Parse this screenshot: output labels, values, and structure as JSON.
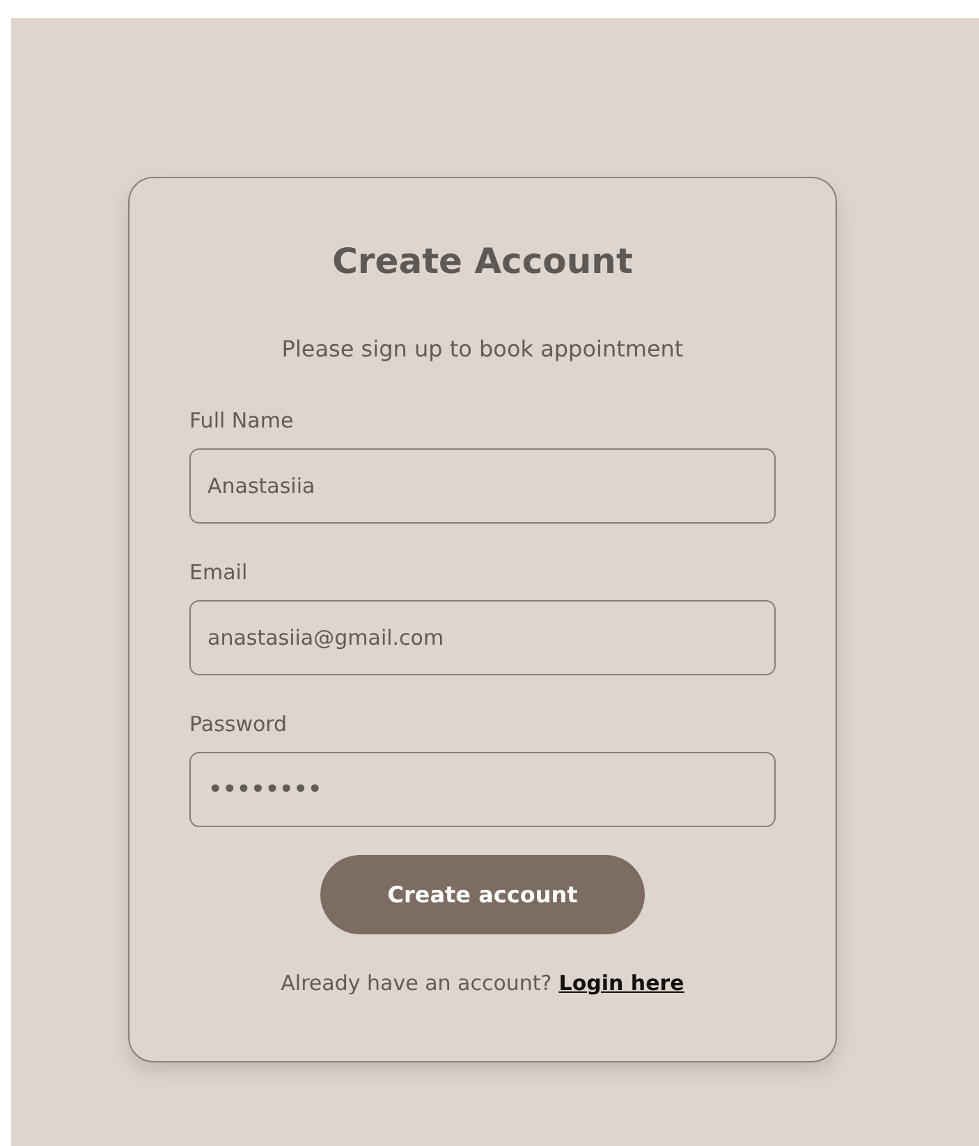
{
  "title": "Create Account",
  "subtitle": "Please sign up to book appointment",
  "fields": [
    {
      "label": "Full Name",
      "kind": "text",
      "value": "Anastasiia"
    },
    {
      "label": "Email",
      "kind": "email",
      "value": "anastasiia@gmail.com"
    },
    {
      "label": "Password",
      "kind": "password",
      "value": "••••••••"
    }
  ],
  "submit": "Create account",
  "footer": {
    "text": "Already have an account?",
    "link": "Login here"
  }
}
